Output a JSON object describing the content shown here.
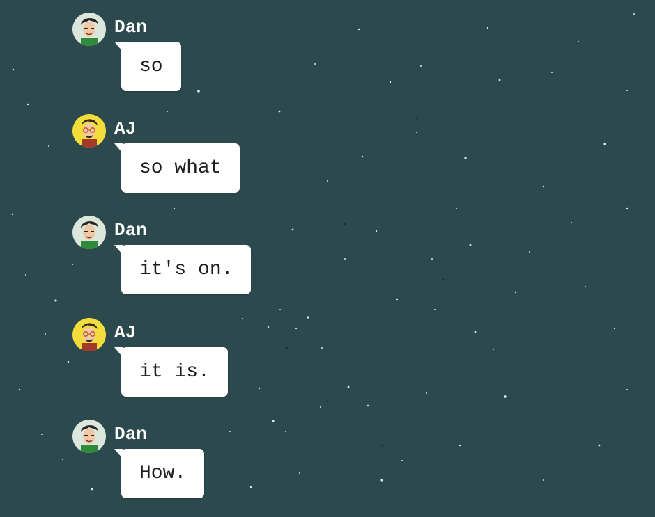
{
  "theme": {
    "background": "#2c4a4d",
    "bubble": "#ffffff",
    "name_color": "#ffffff",
    "text_color": "#1e1e1e",
    "dan_avatar_bg": "#dbe6dc",
    "aj_avatar_bg": "#f2dd3a"
  },
  "messages": [
    {
      "sender": "Dan",
      "avatar": "dan-avatar",
      "text": "so"
    },
    {
      "sender": "AJ",
      "avatar": "aj-avatar",
      "text": "so what"
    },
    {
      "sender": "Dan",
      "avatar": "dan-avatar",
      "text": "it's on."
    },
    {
      "sender": "AJ",
      "avatar": "aj-avatar",
      "text": "it is."
    },
    {
      "sender": "Dan",
      "avatar": "dan-avatar",
      "text": "How."
    }
  ]
}
